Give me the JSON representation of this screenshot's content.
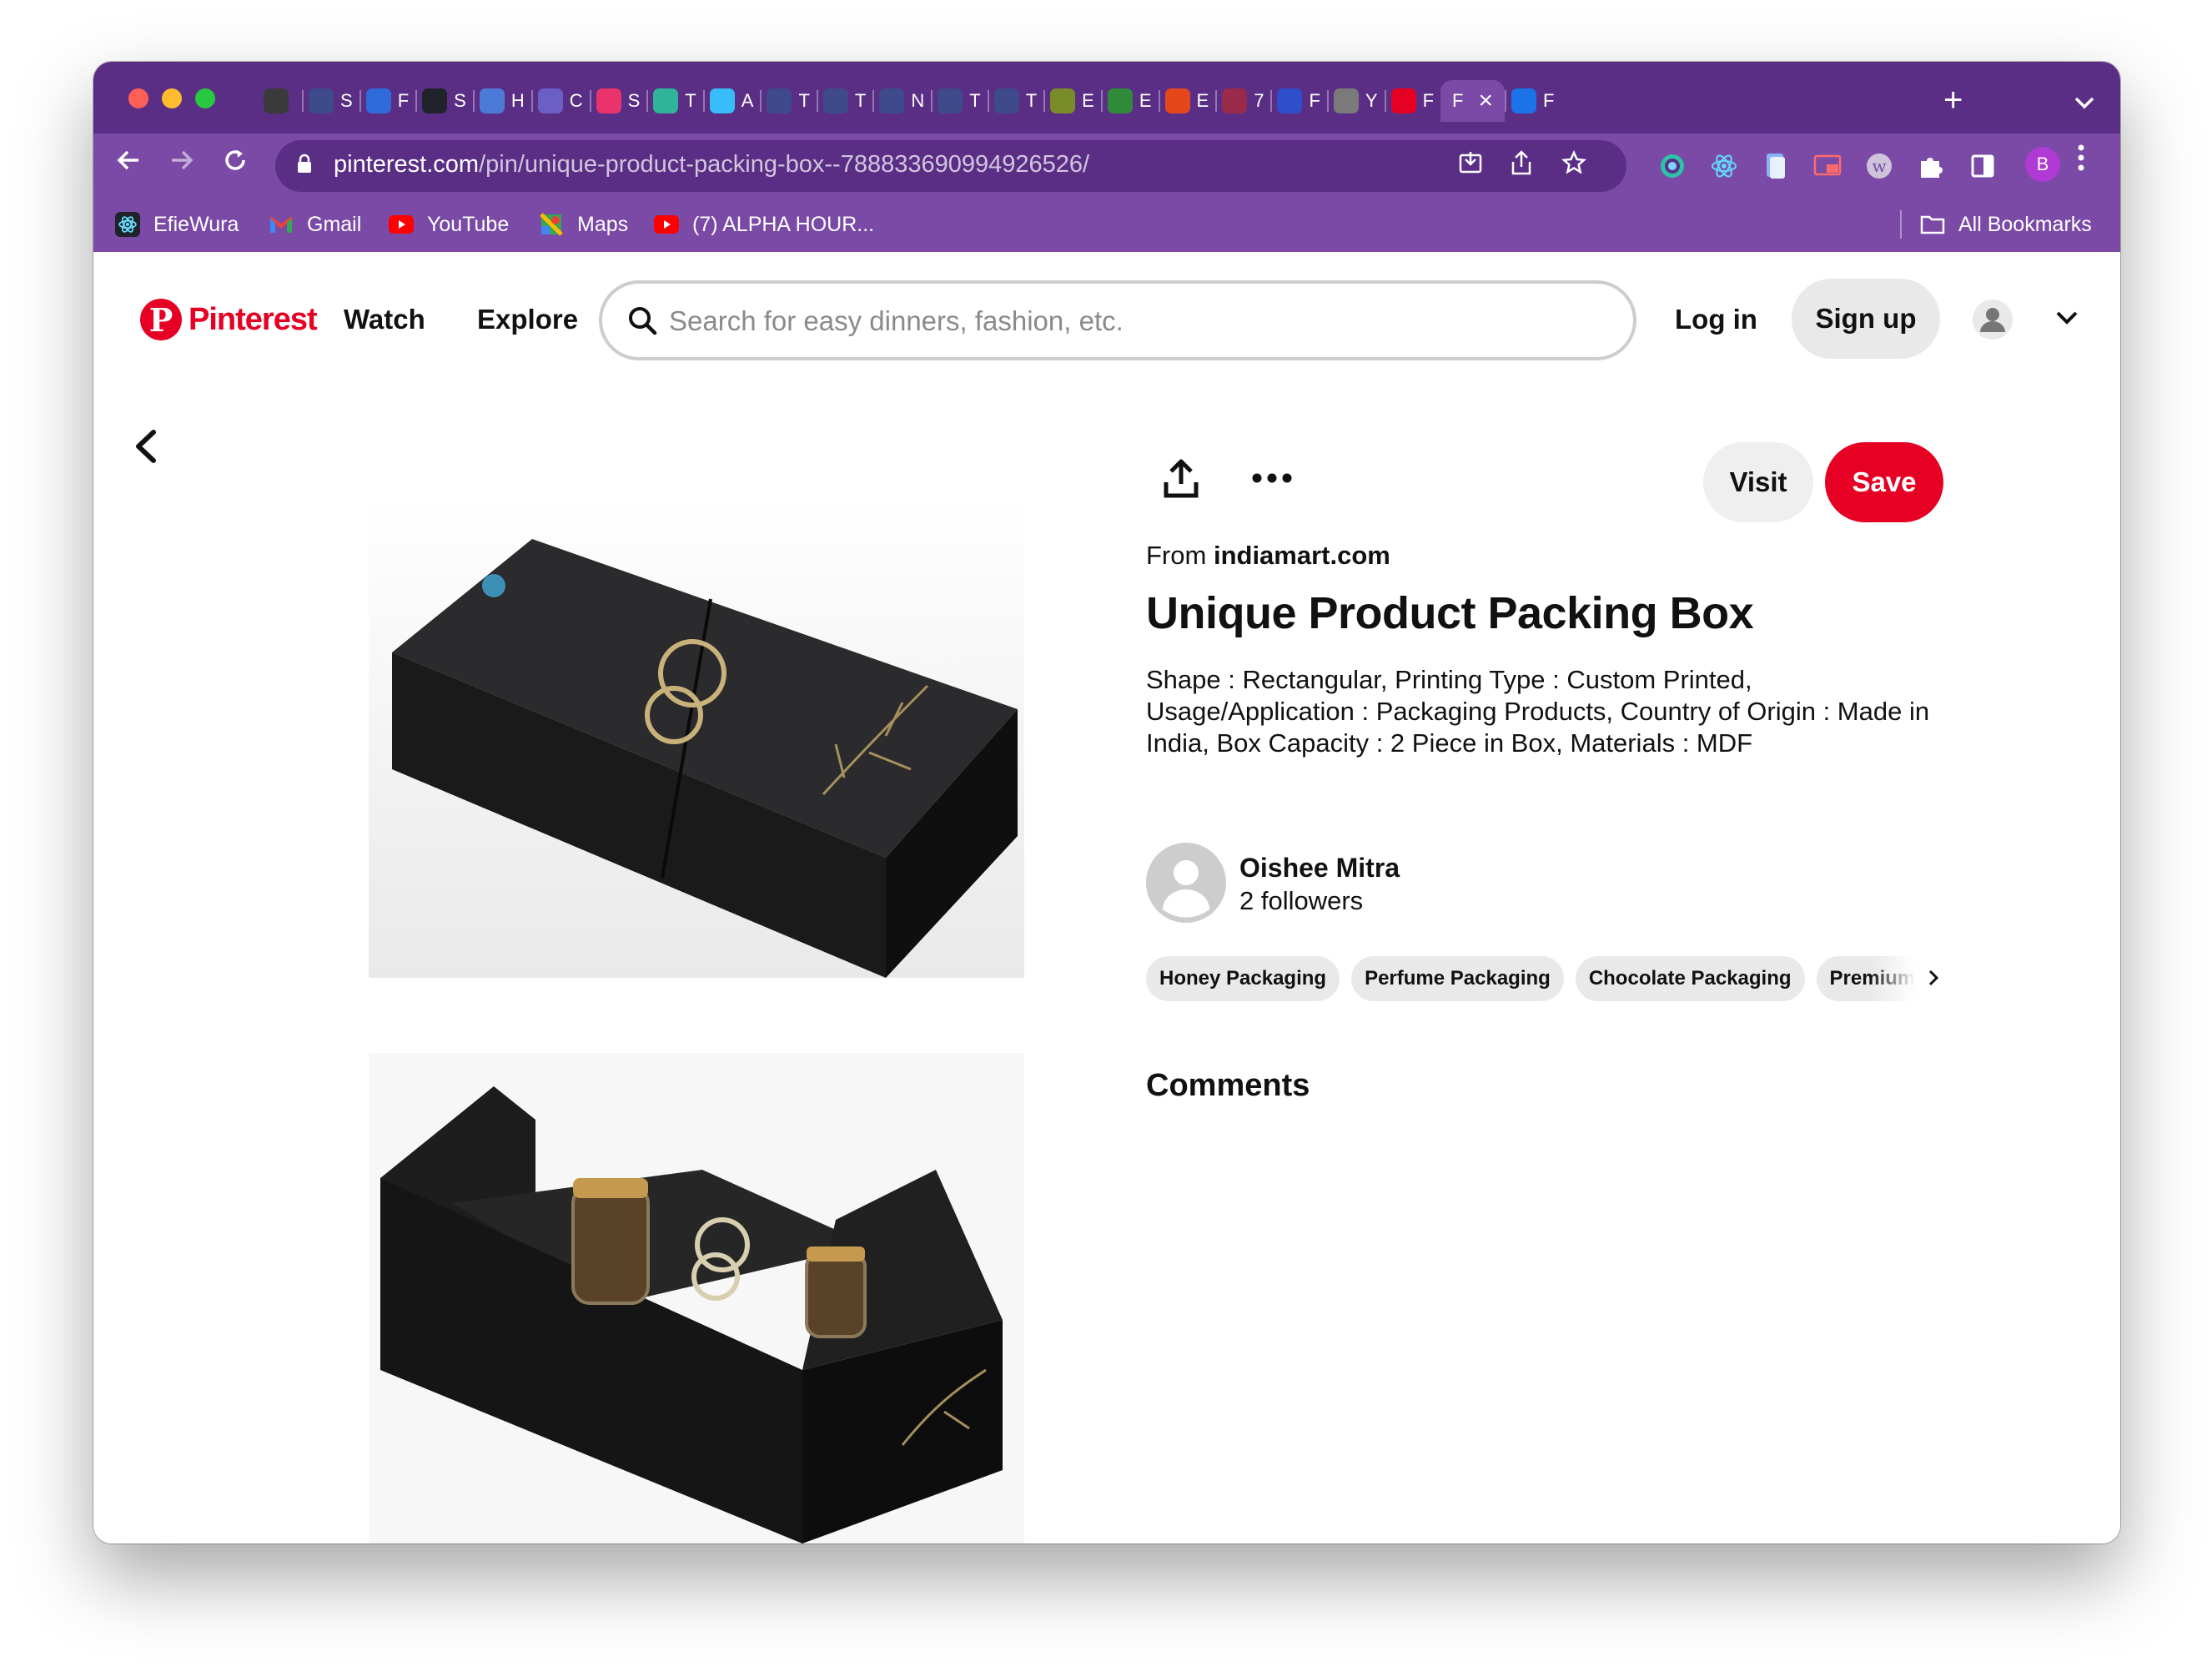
{
  "browser": {
    "tabs": [
      {
        "letter": "",
        "icon": "widget-icon",
        "color": "#3a3a3a"
      },
      {
        "letter": "S",
        "icon": "site-icon",
        "color": "#3f4a8a"
      },
      {
        "letter": "F",
        "icon": "window-icon",
        "color": "#2f6bd8"
      },
      {
        "letter": "S",
        "icon": "react-icon",
        "color": "#20232a"
      },
      {
        "letter": "H",
        "icon": "flower-icon",
        "color": "#4b7bd6"
      },
      {
        "letter": "C",
        "icon": "site-icon",
        "color": "#6b5fc5"
      },
      {
        "letter": "S",
        "icon": "s-icon",
        "color": "#e8336d"
      },
      {
        "letter": "T",
        "icon": "leaf-icon",
        "color": "#2fb39a"
      },
      {
        "letter": "A",
        "icon": "tailwind-icon",
        "color": "#38bdf8"
      },
      {
        "letter": "T",
        "icon": "site-icon",
        "color": "#3f4a8a"
      },
      {
        "letter": "T",
        "icon": "site-icon",
        "color": "#3f4a8a"
      },
      {
        "letter": "N",
        "icon": "site-icon",
        "color": "#3f4a8a"
      },
      {
        "letter": "T",
        "icon": "site-icon",
        "color": "#3f4a8a"
      },
      {
        "letter": "T",
        "icon": "t-icon",
        "color": "#3f4a8a"
      },
      {
        "letter": "E",
        "icon": "e-icon",
        "color": "#7a8b2a"
      },
      {
        "letter": "E",
        "icon": "e-icon",
        "color": "#2f8a3a"
      },
      {
        "letter": "E",
        "icon": "e-icon",
        "color": "#e5471b"
      },
      {
        "letter": "7",
        "icon": "record-icon",
        "color": "#9a2a4a"
      },
      {
        "letter": "F",
        "icon": "translate-icon",
        "color": "#2e4fc9"
      },
      {
        "letter": "Y",
        "icon": "target-icon",
        "color": "#7a7a7a"
      },
      {
        "letter": "F",
        "icon": "pinterest-icon",
        "color": "#e60023"
      },
      {
        "letter": "F",
        "icon": "",
        "color": "",
        "active": true
      },
      {
        "letter": "F",
        "icon": "c-icon",
        "color": "#1a73e8"
      }
    ],
    "url_domain": "pinterest.com",
    "url_path": "/pin/unique-product-packing-box--788833690994926526/",
    "profile_initial": "B",
    "bookmarks": [
      {
        "label": "EfieWura",
        "icon": "react-icon"
      },
      {
        "label": "Gmail",
        "icon": "gmail-icon"
      },
      {
        "label": "YouTube",
        "icon": "youtube-icon"
      },
      {
        "label": "Maps",
        "icon": "maps-icon"
      },
      {
        "label": "(7) ALPHA HOUR...",
        "icon": "youtube-icon"
      }
    ],
    "all_bookmarks": "All Bookmarks"
  },
  "header": {
    "logo_text": "Pinterest",
    "watch": "Watch",
    "explore": "Explore",
    "search_placeholder": "Search for easy dinners, fashion, etc.",
    "login": "Log in",
    "signup": "Sign up"
  },
  "pin": {
    "visit": "Visit",
    "save": "Save",
    "from_prefix": "From",
    "from_domain": "indiamart.com",
    "title": "Unique Product Packing Box",
    "description": "Shape : Rectangular, Printing Type : Custom Printed, Usage/Application : Packaging Products, Country of Origin : Made in India, Box Capacity : 2 Piece in Box, Materials : MDF",
    "author_name": "Oishee Mitra",
    "followers": "2 followers",
    "tags": [
      "Honey Packaging",
      "Perfume Packaging",
      "Chocolate Packaging",
      "Premium"
    ],
    "comments_heading": "Comments"
  },
  "colors": {
    "chrome_dark": "#5b2e86",
    "chrome_light": "#7a4aa6",
    "brand_red": "#e60023",
    "chip_bg": "#e9e9e9"
  }
}
